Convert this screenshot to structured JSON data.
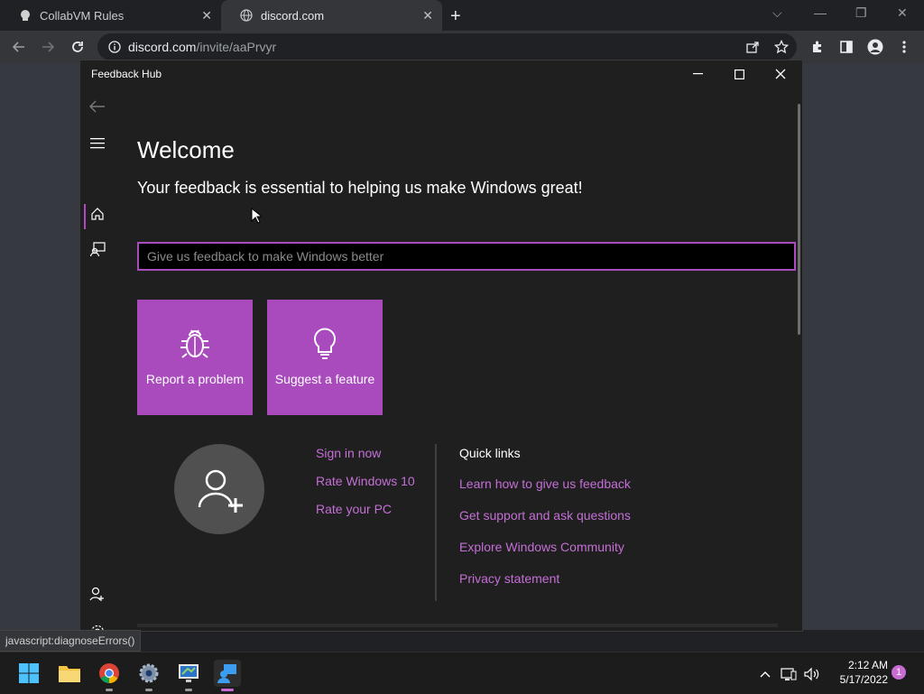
{
  "browser": {
    "tabs": [
      {
        "title": "CollabVM Rules",
        "icon": "collabvm-icon"
      },
      {
        "title": "discord.com",
        "icon": "globe-icon"
      }
    ],
    "url_host": "discord.com",
    "url_path": "/invite/aaPrvyr",
    "status_text": "javascript:diagnoseErrors()"
  },
  "app": {
    "title": "Feedback Hub",
    "welcome": "Welcome",
    "subtitle": "Your feedback is essential to helping us make Windows great!",
    "search_placeholder": "Give us feedback to make Windows better",
    "tiles": [
      {
        "label": "Report a problem",
        "icon": "bug-icon"
      },
      {
        "label": "Suggest a feature",
        "icon": "lightbulb-icon"
      }
    ],
    "account_links": [
      "Sign in now",
      "Rate Windows 10",
      "Rate your PC"
    ],
    "quick_links_title": "Quick links",
    "quick_links": [
      "Learn how to give us feedback",
      "Get support and ask questions",
      "Explore Windows Community",
      "Privacy statement"
    ]
  },
  "taskbar": {
    "time": "2:12 AM",
    "date": "5/17/2022",
    "notifications": "1"
  },
  "colors": {
    "accent": "#a94bbd",
    "link": "#c46fd6",
    "app_bg": "#1f1f1f"
  }
}
